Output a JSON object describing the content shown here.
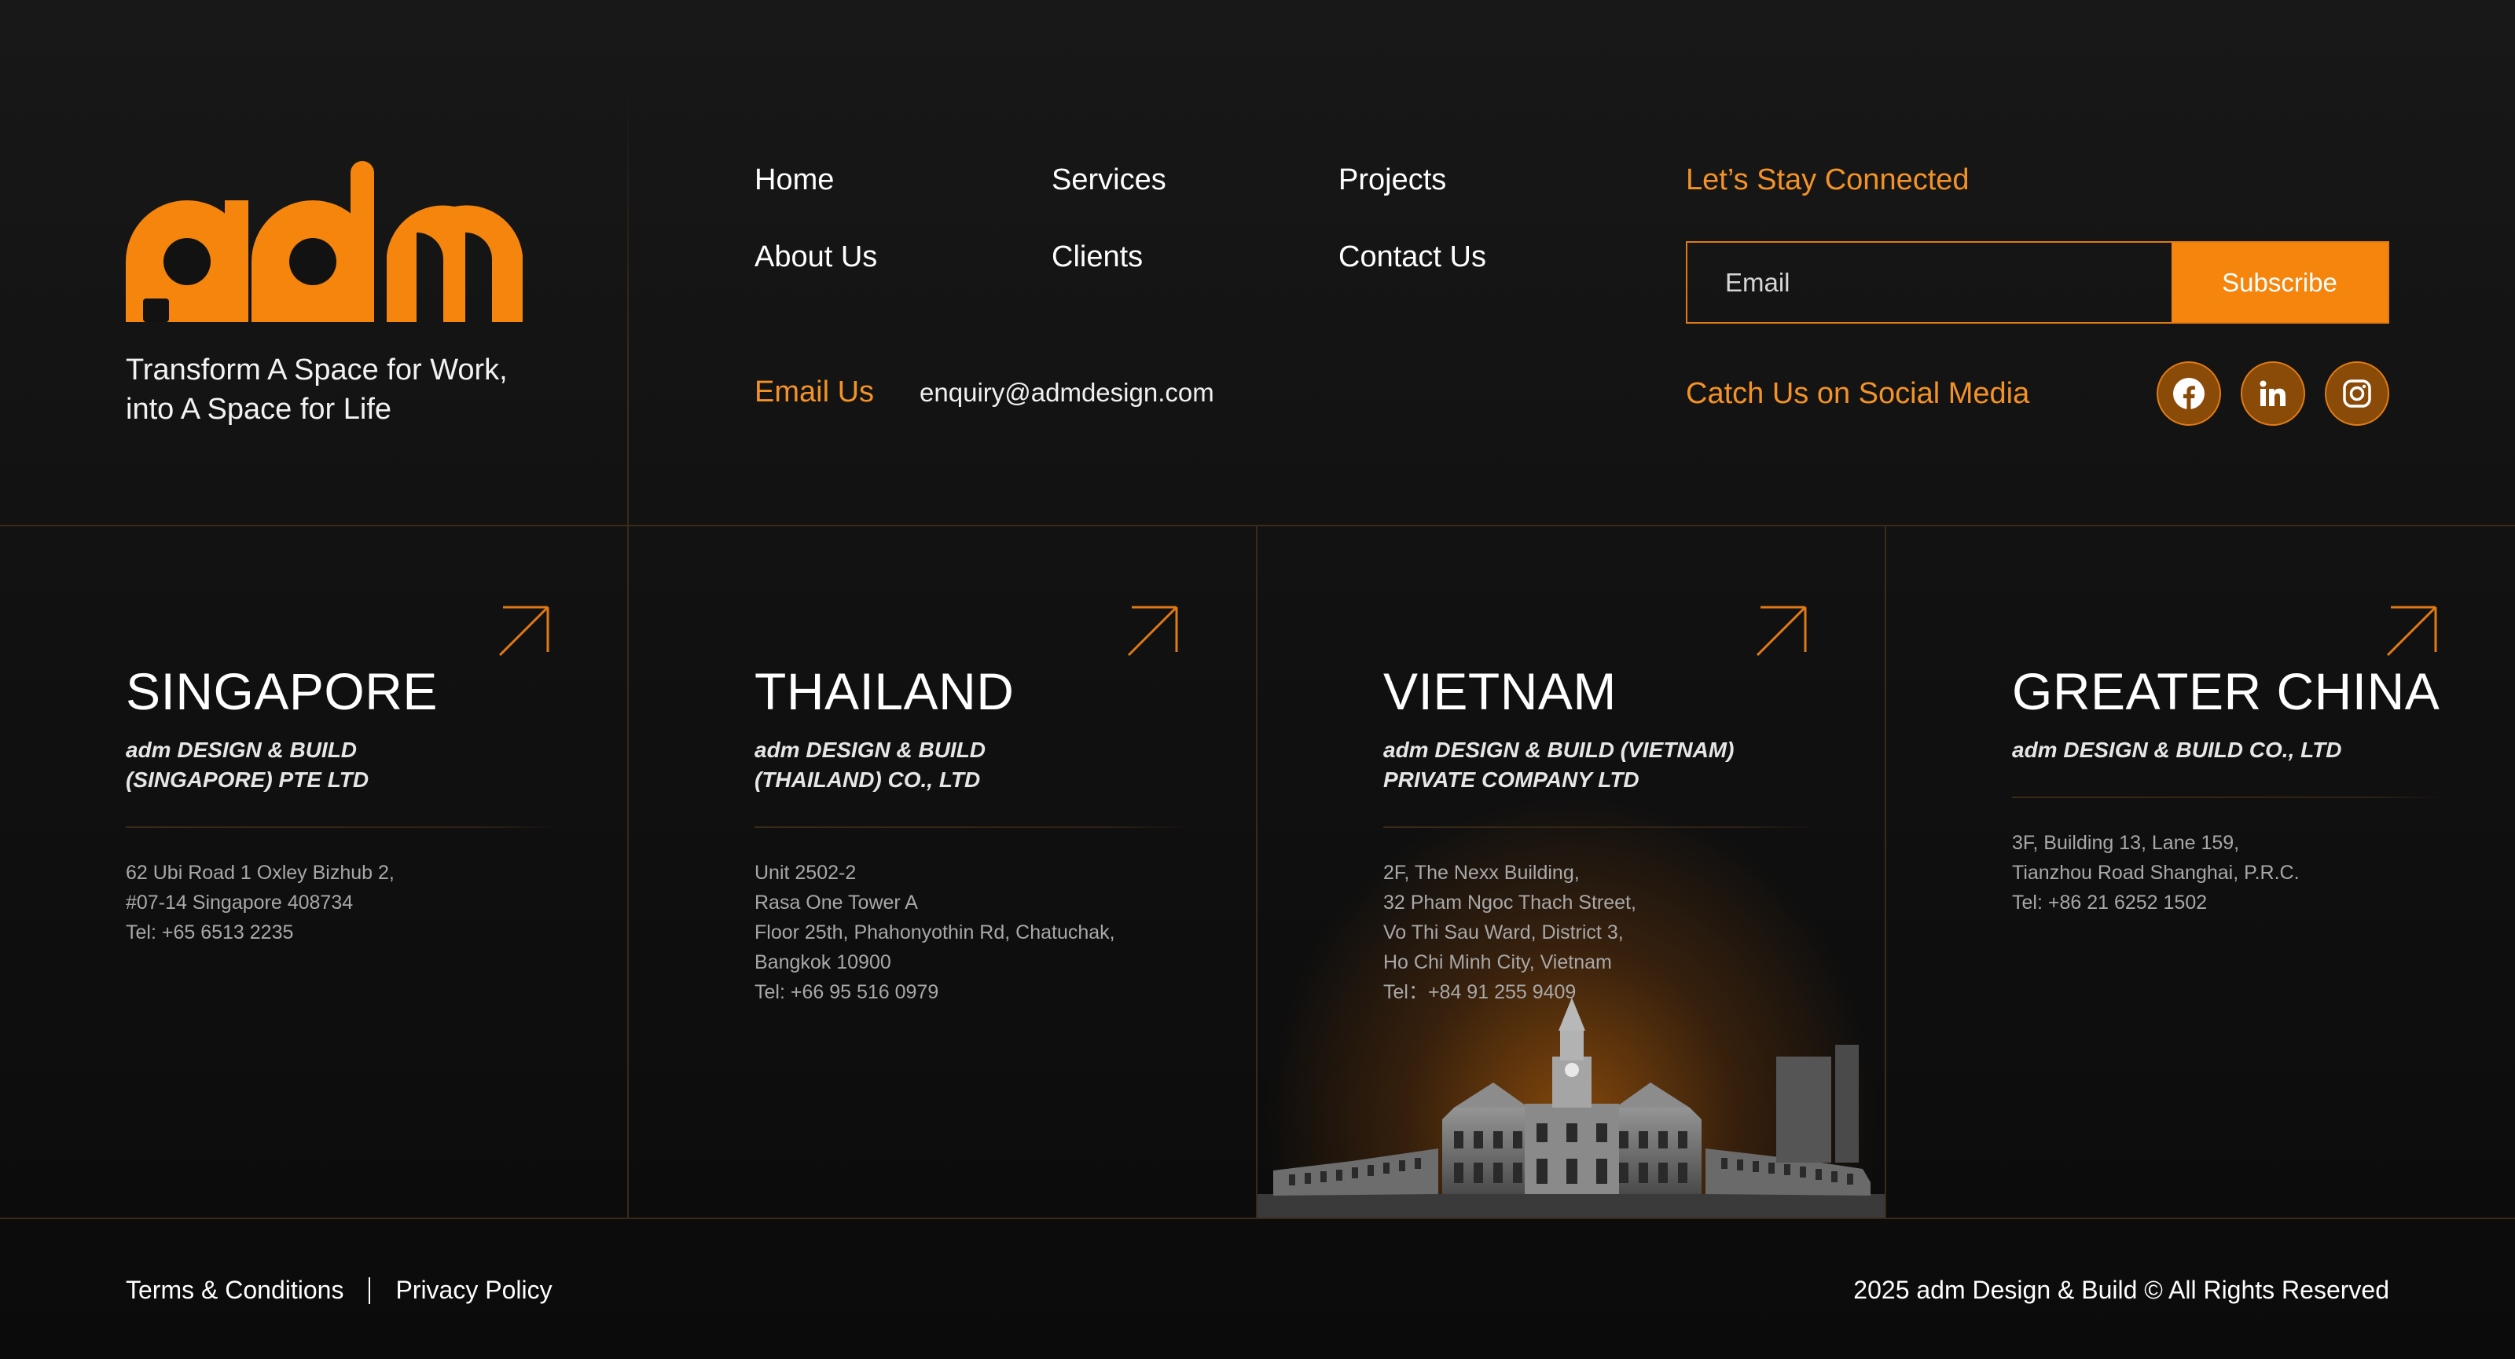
{
  "brand": {
    "logo_text": "adm",
    "tagline_line1": "Transform A Space for Work,",
    "tagline_line2": "into A Space for Life"
  },
  "nav": {
    "items": [
      {
        "label": "Home"
      },
      {
        "label": "Services"
      },
      {
        "label": "Projects"
      },
      {
        "label": "About Us"
      },
      {
        "label": "Clients"
      },
      {
        "label": "Contact Us"
      }
    ]
  },
  "contact": {
    "email_label": "Email Us",
    "email_value": "enquiry@admdesign.com"
  },
  "newsletter": {
    "title": "Let’s Stay Connected",
    "input_placeholder": "Email",
    "button_label": "Subscribe"
  },
  "social": {
    "label": "Catch Us on Social Media",
    "icons": [
      "facebook-icon",
      "linkedin-icon",
      "instagram-icon"
    ]
  },
  "offices": [
    {
      "name": "SINGAPORE",
      "company_line1": "adm DESIGN & BUILD",
      "company_line2": "(SINGAPORE) PTE LTD",
      "address": [
        "62 Ubi Road 1 Oxley Bizhub 2,",
        "#07-14 Singapore 408734",
        "Tel: +65 6513 2235"
      ]
    },
    {
      "name": "THAILAND",
      "company_line1": "adm DESIGN & BUILD",
      "company_line2": "(THAILAND) CO., LTD",
      "address": [
        "Unit 2502-2",
        "Rasa One Tower A",
        "Floor 25th,  Phahonyothin Rd,  Chatuchak,",
        "Bangkok 10900",
        "Tel: +66 95 516 0979"
      ]
    },
    {
      "name": "VIETNAM",
      "company_line1": "adm DESIGN & BUILD (VIETNAM)",
      "company_line2": "PRIVATE COMPANY LTD",
      "address": [
        "2F, The Nexx Building,",
        "32 Pham Ngoc Thach Street,",
        "Vo Thi Sau Ward, District 3,",
        "Ho Chi Minh City, Vietnam",
        "Tel：+84 91 255 9409"
      ]
    },
    {
      "name": "GREATER CHINA",
      "company_line1": "adm DESIGN & BUILD CO., LTD",
      "company_line2": "",
      "address": [
        "3F, Building 13, Lane 159,",
        "Tianzhou Road Shanghai, P.R.C.",
        "Tel: +86 21 6252 1502"
      ]
    }
  ],
  "footer": {
    "terms": "Terms & Conditions",
    "privacy": "Privacy Policy",
    "copyright": "2025 adm Design & Build © All Rights Reserved"
  },
  "colors": {
    "accent": "#f5850c",
    "accent_text": "#f39226",
    "background": "#121212",
    "divider": "#3a2a18"
  }
}
